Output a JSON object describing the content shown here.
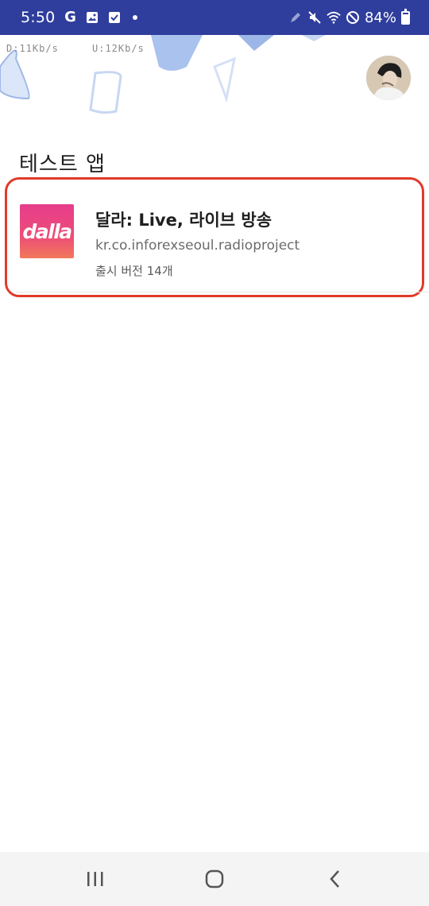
{
  "status_bar": {
    "time": "5:50",
    "left_icons": [
      "google-icon",
      "gallery-icon",
      "checklist-icon",
      "notification-dot-icon"
    ],
    "right_icons": [
      "pen-icon",
      "mute-icon",
      "wifi-icon",
      "do-not-disturb-icon"
    ],
    "battery_percent": "84%",
    "battery_level": 0.84,
    "background_color": "#2f3d9c"
  },
  "network_speed": {
    "download": "D:11Kb/s",
    "upload": "U:12Kb/s"
  },
  "section": {
    "title": "테스트 앱"
  },
  "app": {
    "name": "달라: Live, 라이브 방송",
    "package": "kr.co.inforexseoul.radioproject",
    "versions": "출시 버전 14개",
    "icon_text": "dalla",
    "icon_colors": [
      "#e73c8c",
      "#f2795a"
    ],
    "highlight_color": "#e23a2a"
  },
  "nav_bar": {
    "buttons": [
      "recents-icon",
      "home-icon",
      "back-icon"
    ]
  }
}
